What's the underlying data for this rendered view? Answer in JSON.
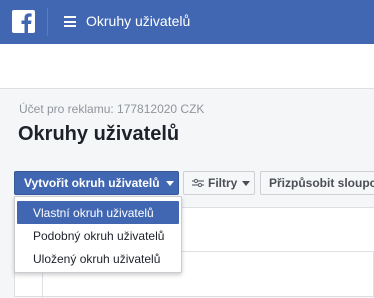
{
  "topbar": {
    "title": "Okruhy uživatelů",
    "logo": "facebook-logo",
    "menu_icon": "hamburger-icon"
  },
  "header": {
    "account": "Účet pro reklamu: 177812020 CZK",
    "title": "Okruhy uživatelů"
  },
  "toolbar": {
    "create_label": "Vytvořit okruh uživatelů",
    "filters_label": "Filtry",
    "customize_label": "Přizpůsobit sloupce"
  },
  "dropdown": {
    "items": [
      {
        "label": "Vlastní okruh uživatelů",
        "active": true
      },
      {
        "label": "Podobný okruh uživatelů",
        "active": false
      },
      {
        "label": "Uložený okruh uživatelů",
        "active": false
      }
    ]
  },
  "colors": {
    "brand": "#4267b2",
    "background": "#f5f6f7"
  }
}
